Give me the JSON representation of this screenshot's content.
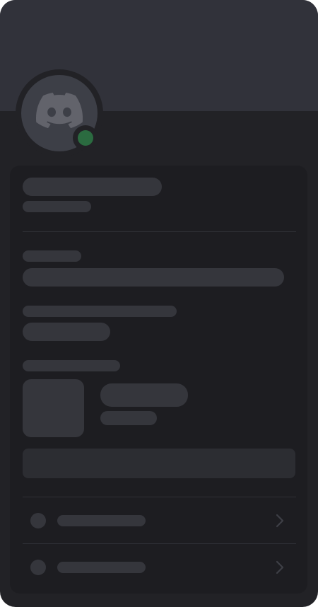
{
  "profile": {
    "status_color": "#2b6b40",
    "banner_color": "#31323a",
    "avatar_icon": "discord-logo-icon"
  },
  "rows": [
    {
      "icon": "circle-icon",
      "action_icon": "chevron-right-icon"
    },
    {
      "icon": "circle-icon",
      "action_icon": "chevron-right-icon"
    }
  ]
}
